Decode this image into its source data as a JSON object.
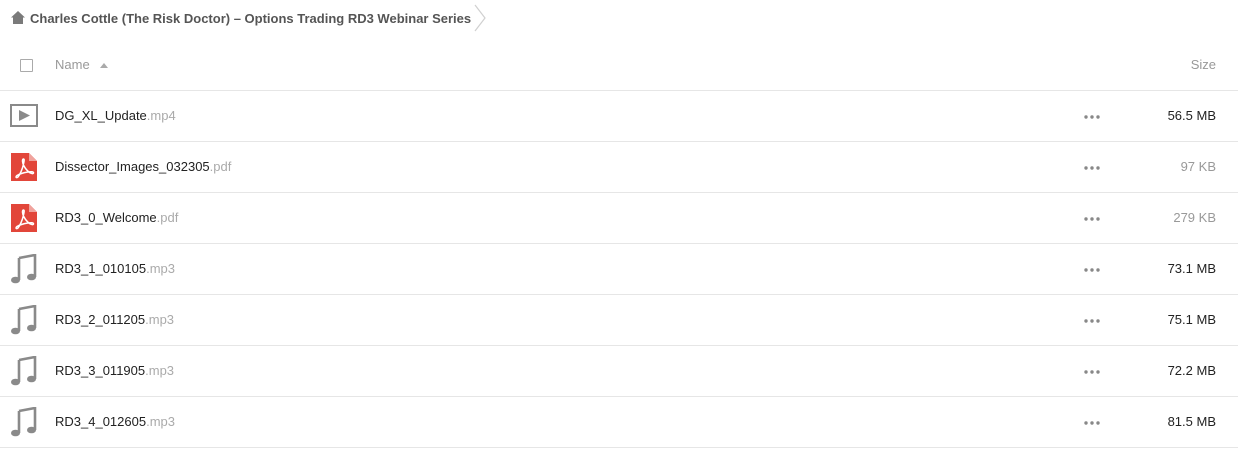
{
  "breadcrumb": {
    "label": "Charles Cottle (The Risk Doctor) – Options Trading RD3 Webinar Series",
    "home_icon": "home-icon",
    "chevron_icon": "chevron-right-icon"
  },
  "table": {
    "columns": {
      "name": "Name",
      "size": "Size"
    },
    "sort": {
      "column": "name",
      "direction": "ascending"
    },
    "rows": [
      {
        "name": "DG_XL_Update",
        "ext": ".mp4",
        "size": "56.5 MB",
        "icon": "video-file-icon",
        "size_color": "#222222"
      },
      {
        "name": "Dissector_Images_032305",
        "ext": ".pdf",
        "size": "97 KB",
        "icon": "pdf-file-icon",
        "size_color": "#999999"
      },
      {
        "name": "RD3_0_Welcome",
        "ext": ".pdf",
        "size": "279 KB",
        "icon": "pdf-file-icon",
        "size_color": "#999999"
      },
      {
        "name": "RD3_1_010105",
        "ext": ".mp3",
        "size": "73.1 MB",
        "icon": "audio-file-icon",
        "size_color": "#222222"
      },
      {
        "name": "RD3_2_011205",
        "ext": ".mp3",
        "size": "75.1 MB",
        "icon": "audio-file-icon",
        "size_color": "#222222"
      },
      {
        "name": "RD3_3_011905",
        "ext": ".mp3",
        "size": "72.2 MB",
        "icon": "audio-file-icon",
        "size_color": "#222222"
      },
      {
        "name": "RD3_4_012605",
        "ext": ".mp3",
        "size": "81.5 MB",
        "icon": "audio-file-icon",
        "size_color": "#222222"
      }
    ]
  },
  "colors": {
    "pdf_red": "#e2463a",
    "icon_gray": "#8a8a8a",
    "divider": "#e6e6e6",
    "muted_text": "#999999"
  }
}
